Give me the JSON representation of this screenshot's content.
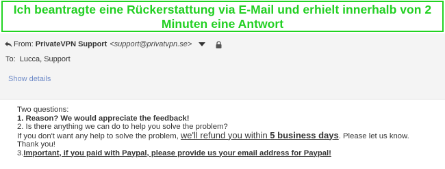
{
  "caption": {
    "line1": "Ich beantragte eine Rückerstattung via E-Mail und erhielt innerhalb von 2",
    "line2": "Minuten eine Antwort",
    "color": "#22d022"
  },
  "email_header": {
    "from_label": "From:",
    "sender_name": "PrivateVPN Support",
    "sender_email": "<support@privatvpn.se>",
    "to_label": "To:",
    "recipients": "Lucca, Support",
    "show_details": "Show details",
    "icons": [
      "reply-icon",
      "chevron-down-icon",
      "lock-icon"
    ],
    "link_color": "#6f8bc8"
  },
  "email_body": {
    "intro": "Two questions:",
    "q1": "1. Reason? We would appreciate the feedback!",
    "q2": "2. Is there anything we can do to help you solve the problem?",
    "refund_prefix": "If you don't want any help to solve the problem, ",
    "refund_link": "we'll refund you within ",
    "refund_days": "5 business days",
    "refund_suffix": ". Please let us know.",
    "thanks": "Thank you!",
    "q3_number": "3.",
    "q3_text": "Important, if you paid with Paypal, please provide us your email address for Paypal!"
  }
}
